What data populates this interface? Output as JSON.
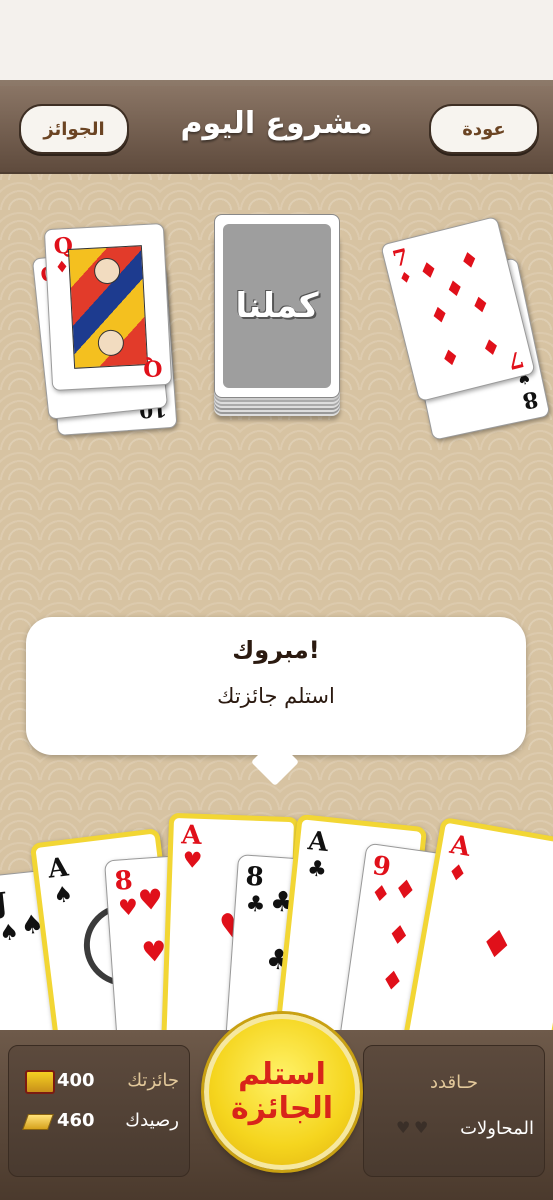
{
  "header": {
    "title": "مشروع اليوم",
    "back_label": "عودة",
    "prizes_label": "الجوائز"
  },
  "table_cards": {
    "left": [
      {
        "rank": "10",
        "suit": "diamonds"
      },
      {
        "rank": "Q",
        "suit": "diamonds"
      },
      {
        "rank": "Q",
        "suit": "diamonds"
      }
    ],
    "right": [
      {
        "rank": "8",
        "suit": "spades"
      },
      {
        "rank": "7",
        "suit": "diamonds"
      }
    ],
    "deck_logo": "كملنا"
  },
  "message": {
    "title": "مبروك!",
    "text": "استلم جائزتك"
  },
  "hand": [
    {
      "rank": "J",
      "suit": "spades"
    },
    {
      "rank": "A",
      "suit": "spades"
    },
    {
      "rank": "8",
      "suit": "hearts"
    },
    {
      "rank": "A",
      "suit": "hearts"
    },
    {
      "rank": "8",
      "suit": "clubs"
    },
    {
      "rank": "A",
      "suit": "clubs"
    },
    {
      "rank": "9",
      "suit": "diamonds"
    },
    {
      "rank": "A",
      "suit": "diamonds"
    }
  ],
  "footer": {
    "claim_line1": "استلم",
    "claim_line2": "الجائزة",
    "prize_label": "جائزتك",
    "prize_value": "400",
    "balance_label": "رصيدك",
    "balance_value": "460",
    "trick_label": "حـاقدد",
    "attempts_label": "المحاولات"
  },
  "colors": {
    "accent_gold": "#f5d51e",
    "claim_text": "#d8241a",
    "brown": "#5f4b3d"
  }
}
